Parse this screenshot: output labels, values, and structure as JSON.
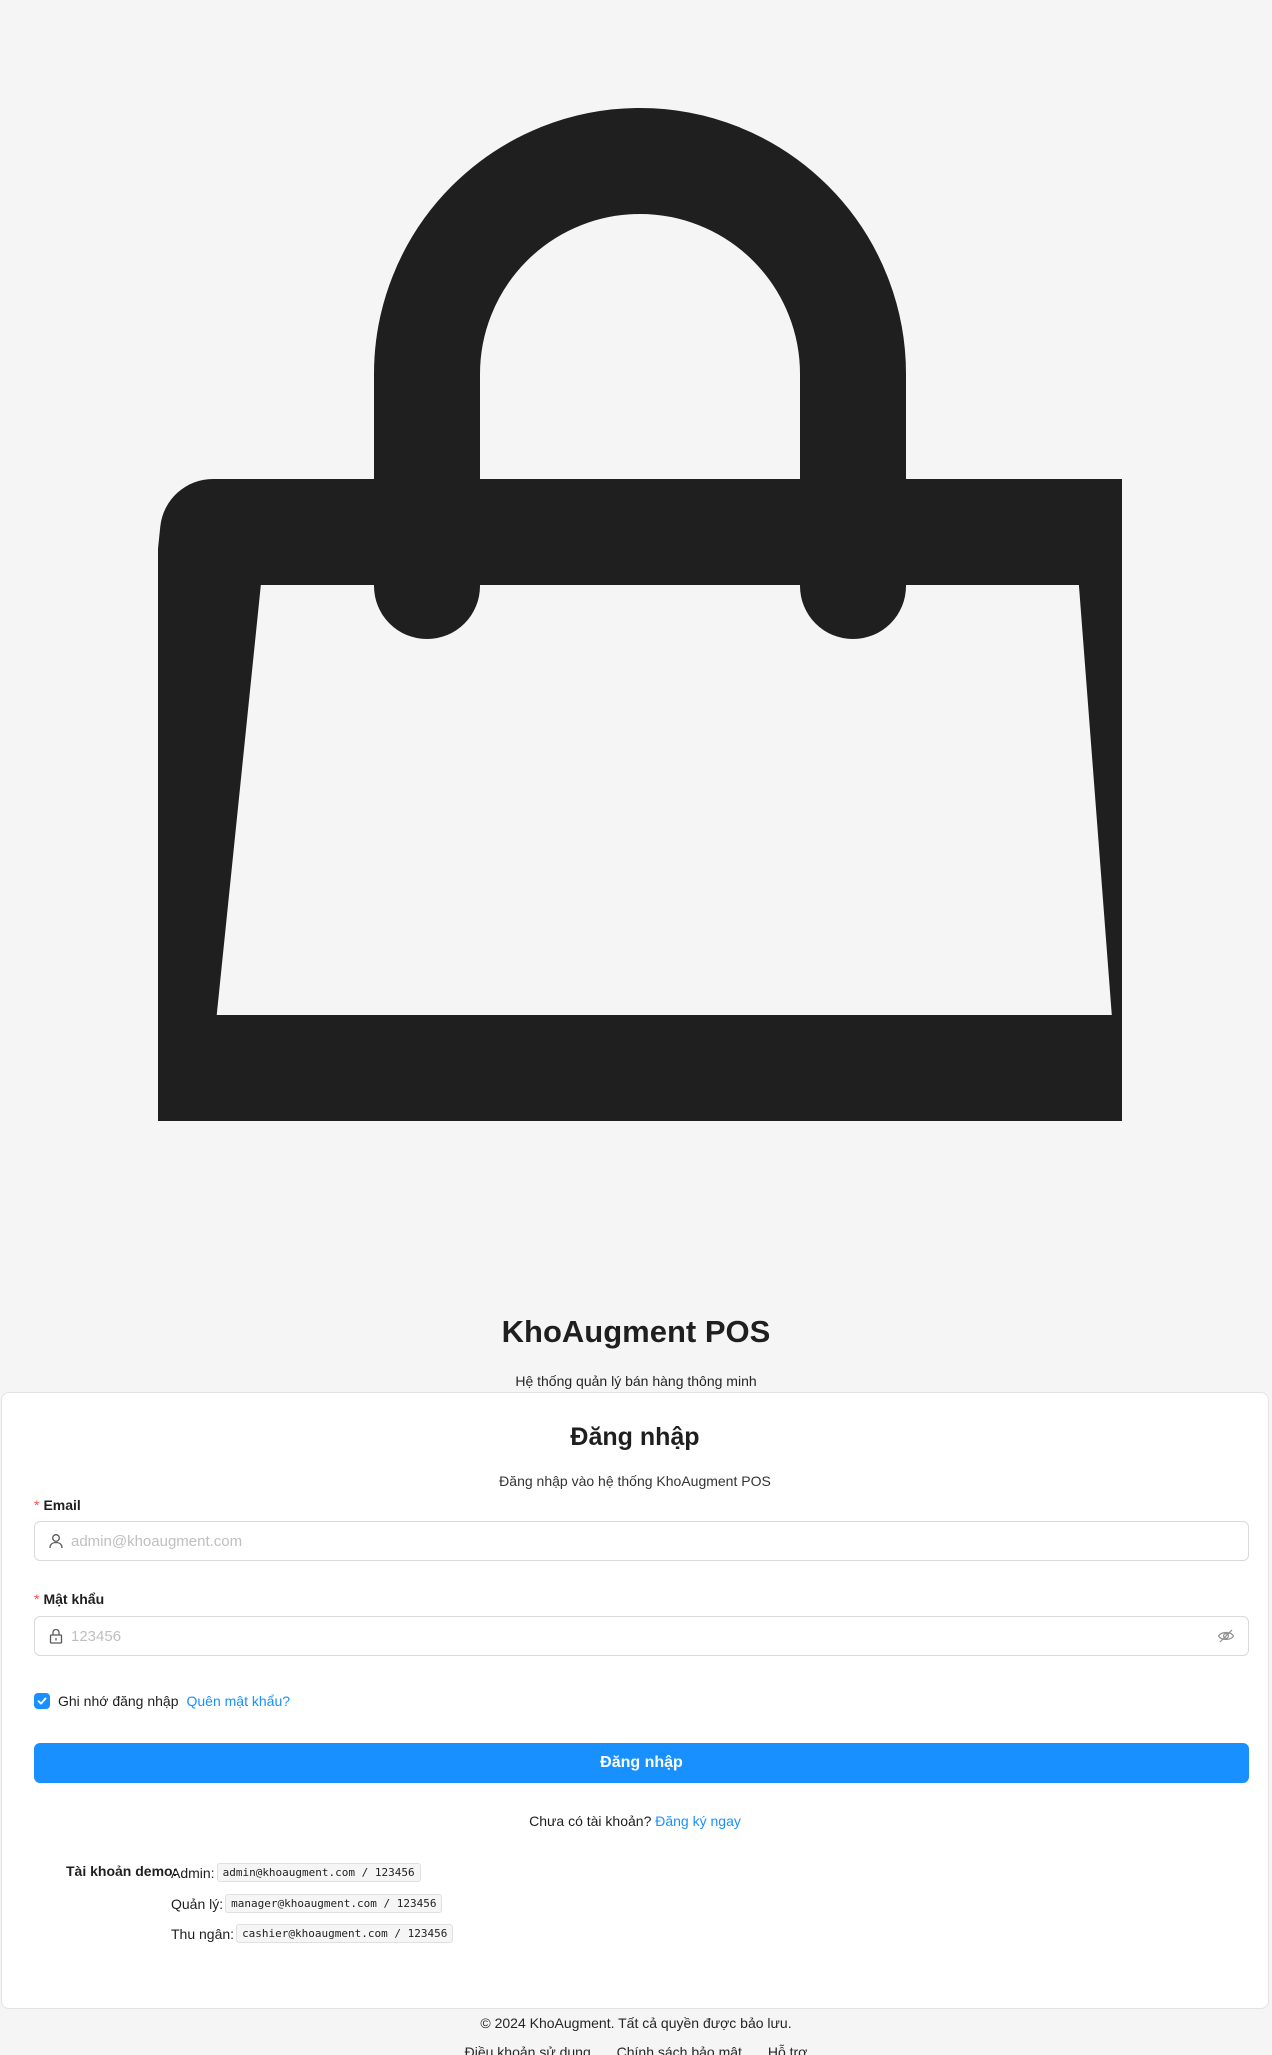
{
  "brand": {
    "logo_icon": "shopping-bag-icon",
    "title": "KhoAugment POS",
    "subtitle": "Hệ thống quản lý bán hàng thông minh"
  },
  "login_card": {
    "title": "Đăng nhập",
    "subtitle": "Đăng nhập vào hệ thống KhoAugment POS",
    "email": {
      "label": "Email",
      "placeholder": "admin@khoaugment.com",
      "value": "",
      "icon": "user-icon"
    },
    "password": {
      "label": "Mật khẩu",
      "placeholder": "123456",
      "value": "",
      "icon": "lock-icon",
      "toggle_icon": "eye-invisible-icon"
    },
    "remember_me": {
      "label": "Ghi nhớ đăng nhập",
      "checked": true
    },
    "forgot_password": "Quên mật khẩu?",
    "submit_label": "Đăng nhập",
    "register_prompt": "Chưa có tài khoản?",
    "register_link": "Đăng ký ngay",
    "demo_accounts": {
      "title": "Tài khoản demo:",
      "rows": [
        {
          "role": "Admin:",
          "credentials": "admin@khoaugment.com / 123456"
        },
        {
          "role": "Quản lý:",
          "credentials": "manager@khoaugment.com / 123456"
        },
        {
          "role": "Thu ngân:",
          "credentials": "cashier@khoaugment.com / 123456"
        }
      ]
    }
  },
  "footer": {
    "copyright": "© 2024 KhoAugment. Tất cả quyền được bảo lưu.",
    "links": [
      "Điều khoản sử dụng",
      "Chính sách bảo mật",
      "Hỗ trợ"
    ]
  },
  "colors": {
    "primary": "#1890ff",
    "required": "#ff4d4f",
    "background": "#f5f5f5",
    "logo": "#1f1f1f"
  }
}
